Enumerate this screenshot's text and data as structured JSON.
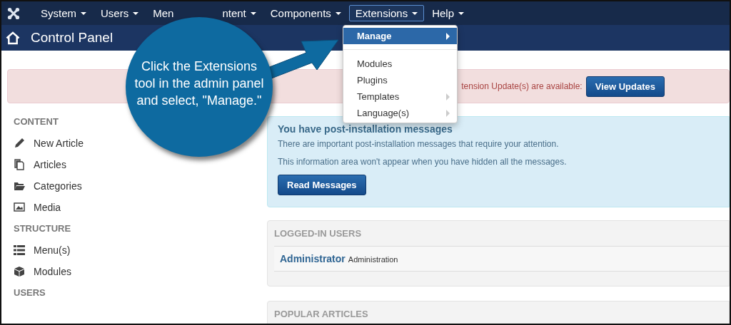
{
  "navbar": {
    "items": [
      {
        "label": "System",
        "selected": false,
        "caret": true
      },
      {
        "label": "Users",
        "selected": false,
        "caret": true
      },
      {
        "label": "Men",
        "selected": false,
        "caret": false
      },
      {
        "label": "ntent",
        "selected": false,
        "caret": true
      },
      {
        "label": "Components",
        "selected": false,
        "caret": true
      },
      {
        "label": "Extensions",
        "selected": true,
        "caret": true
      },
      {
        "label": "Help",
        "selected": false,
        "caret": true
      }
    ]
  },
  "dropdown": {
    "items": [
      {
        "label": "Manage",
        "selected": true,
        "submenu": true,
        "divider_after": true
      },
      {
        "label": "Modules",
        "selected": false,
        "submenu": false,
        "divider_after": false
      },
      {
        "label": "Plugins",
        "selected": false,
        "submenu": false,
        "divider_after": false
      },
      {
        "label": "Templates",
        "selected": false,
        "submenu": true,
        "divider_after": false
      },
      {
        "label": "Language(s)",
        "selected": false,
        "submenu": true,
        "divider_after": false
      }
    ]
  },
  "header": {
    "title": "Control Panel"
  },
  "alert": {
    "text": "tension Update(s) are available:",
    "button": "View Updates"
  },
  "sidebar": {
    "sections": [
      {
        "heading": "CONTENT",
        "items": [
          {
            "label": "New Article"
          },
          {
            "label": "Articles"
          },
          {
            "label": "Categories"
          },
          {
            "label": "Media"
          }
        ]
      },
      {
        "heading": "STRUCTURE",
        "items": [
          {
            "label": "Menu(s)"
          },
          {
            "label": "Modules"
          }
        ]
      },
      {
        "heading": "USERS"
      }
    ]
  },
  "post_install": {
    "title": "You have post-installation messages",
    "lines": [
      "There are important post-installation messages that require your attention.",
      "This information area won't appear when you have hidden all the messages."
    ],
    "button": "Read Messages"
  },
  "logged_in": {
    "title": "LOGGED-IN USERS",
    "users": [
      {
        "name": "Administrator",
        "role": "Administration"
      }
    ]
  },
  "popular": {
    "title": "POPULAR ARTICLES"
  },
  "callout": {
    "text": "Click the Extensions tool in the admin panel and select, \"Manage.\""
  }
}
